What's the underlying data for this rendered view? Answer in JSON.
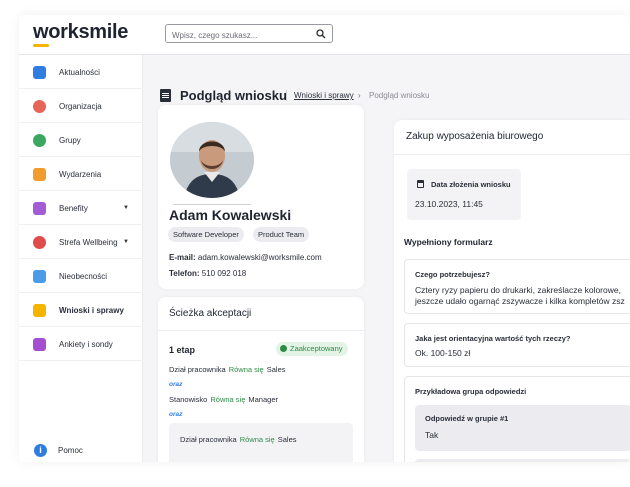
{
  "app": {
    "logo": "worksmile",
    "search_placeholder": "Wpisz, czego szukasz..."
  },
  "colors": {
    "accent": "#f5b400",
    "success": "#2e8b46",
    "link": "#2f7de1"
  },
  "sidebar": {
    "items": [
      {
        "label": "Aktualności",
        "icon": "news-icon"
      },
      {
        "label": "Organizacja",
        "icon": "organization-icon"
      },
      {
        "label": "Grupy",
        "icon": "groups-icon"
      },
      {
        "label": "Wydarzenia",
        "icon": "calendar-icon"
      },
      {
        "label": "Benefity",
        "icon": "benefits-icon"
      },
      {
        "label": "Strefa Wellbeing",
        "icon": "heart-icon"
      },
      {
        "label": "Nieobecności",
        "icon": "absence-icon"
      },
      {
        "label": "Wnioski i sprawy",
        "icon": "requests-icon"
      },
      {
        "label": "Ankiety i sondy",
        "icon": "surveys-icon"
      }
    ],
    "help_label": "Pomoc"
  },
  "page": {
    "title": "Podgląd wniosku",
    "breadcrumb_parent": "Wnioski i sprawy",
    "breadcrumb_current": "Podgląd wniosku"
  },
  "profile": {
    "name": "Adam Kowalewski",
    "tags": [
      "Software Developer",
      "Product Team"
    ],
    "email_label": "E-mail:",
    "email": "adam.kowalewski@worksmile.com",
    "phone_label": "Telefon:",
    "phone": "510 092 018"
  },
  "approval_path": {
    "title": "Ścieżka akceptacji",
    "stage": "1 etap",
    "status": "Zaakceptowany",
    "rules": [
      {
        "field": "Dział pracownika",
        "op": "Równa się",
        "value": "Sales"
      },
      {
        "field": "Stanowisko",
        "op": "Równa się",
        "value": "Manager"
      }
    ],
    "connector": "oraz",
    "sub_rule": {
      "field": "Dział pracownika",
      "op": "Równa się",
      "value": "Sales"
    }
  },
  "request": {
    "title": "Zakup wyposażenia biurowego",
    "date_label": "Data złożenia wniosku",
    "date_value": "23.10.2023, 11:45",
    "form_title": "Wypełniony formularz",
    "questions": [
      {
        "label": "Czego potrzebujesz?",
        "answer_line1": "Cztery ryzy papieru do drukarki, zakreślacze kolorowe,",
        "answer_line2": "jeszcze udało ogarnąć zszywacze i kilka kompletów zsz"
      },
      {
        "label": "Jaka jest orientacyjna wartość tych rzeczy?",
        "answer": "Ok. 100-150 zł"
      },
      {
        "label": "Przykładowa grupa odpowiedzi",
        "group_label": "Odpowiedź w grupie #1",
        "group_answer": "Tak"
      }
    ]
  }
}
